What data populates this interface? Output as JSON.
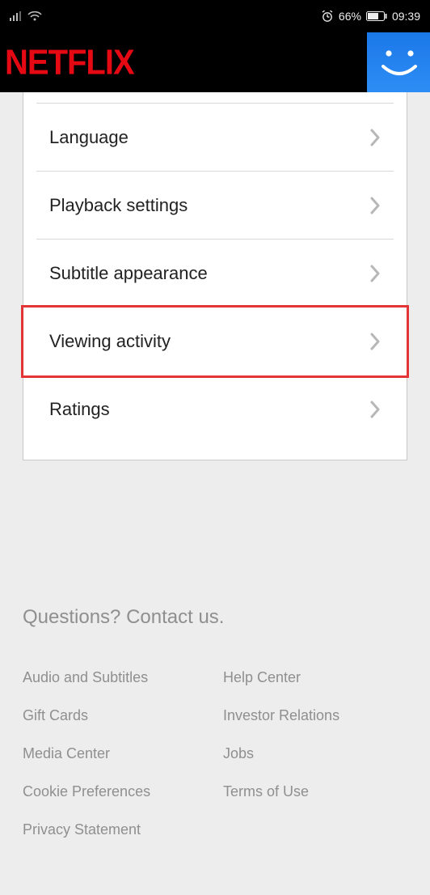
{
  "status_bar": {
    "battery_pct": "66%",
    "time": "09:39"
  },
  "header": {
    "logo_text": "NETFLIX"
  },
  "settings": {
    "rows": [
      {
        "label": "Language",
        "highlighted": false
      },
      {
        "label": "Playback settings",
        "highlighted": false
      },
      {
        "label": "Subtitle appearance",
        "highlighted": false
      },
      {
        "label": "Viewing activity",
        "highlighted": true
      },
      {
        "label": "Ratings",
        "highlighted": false
      }
    ]
  },
  "footer": {
    "title": "Questions? Contact us.",
    "links_col": [
      "Audio and Subtitles",
      "Help Center",
      "Gift Cards",
      "Investor Relations",
      "Media Center",
      "Jobs",
      "Cookie Preferences",
      "Terms of Use",
      "Privacy Statement"
    ]
  }
}
